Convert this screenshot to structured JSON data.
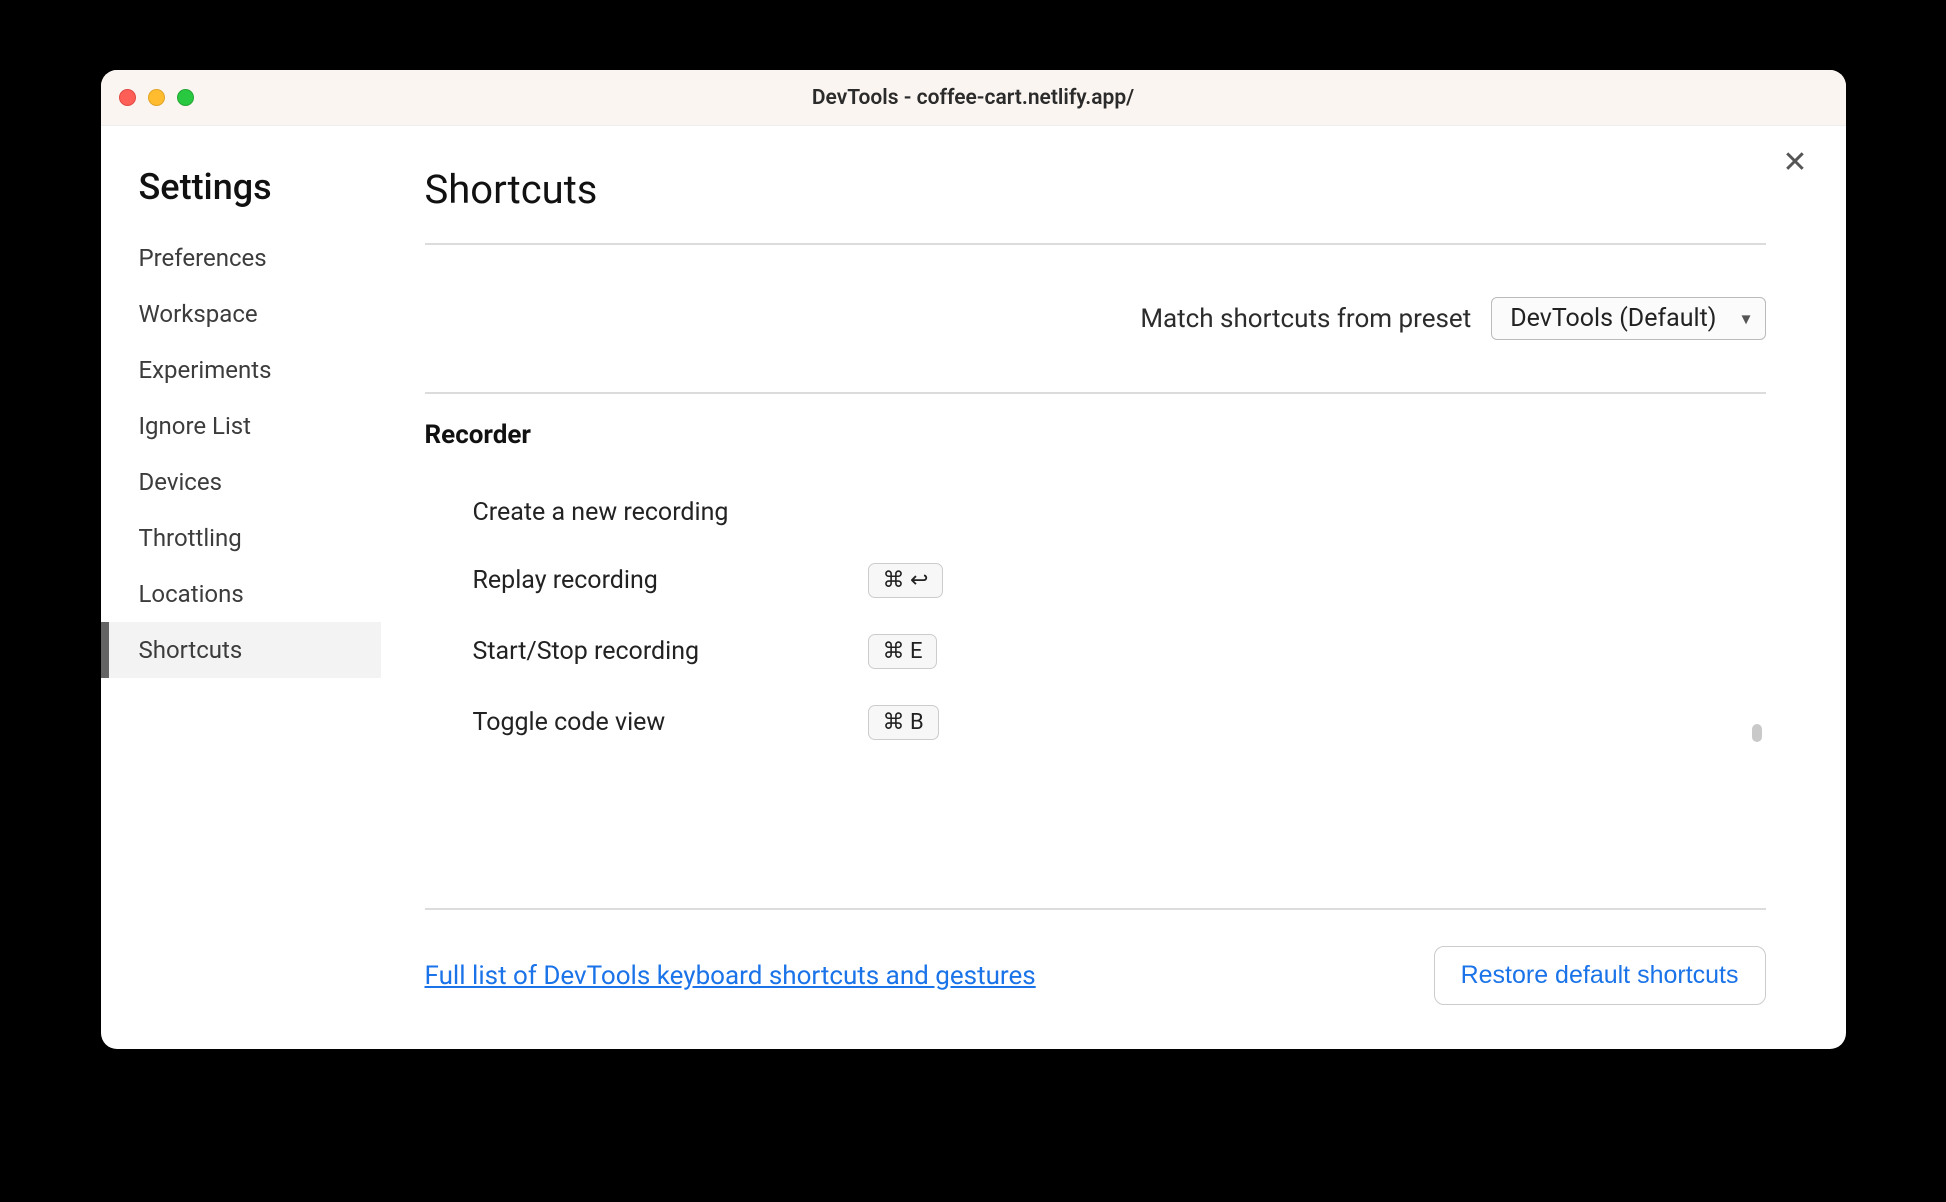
{
  "window": {
    "title": "DevTools - coffee-cart.netlify.app/"
  },
  "sidebar": {
    "title": "Settings",
    "items": [
      {
        "label": "Preferences",
        "selected": false
      },
      {
        "label": "Workspace",
        "selected": false
      },
      {
        "label": "Experiments",
        "selected": false
      },
      {
        "label": "Ignore List",
        "selected": false
      },
      {
        "label": "Devices",
        "selected": false
      },
      {
        "label": "Throttling",
        "selected": false
      },
      {
        "label": "Locations",
        "selected": false
      },
      {
        "label": "Shortcuts",
        "selected": true
      }
    ]
  },
  "page": {
    "heading": "Shortcuts",
    "preset_label": "Match shortcuts from preset",
    "preset_value": "DevTools (Default)"
  },
  "section": {
    "title": "Recorder",
    "rows": [
      {
        "desc": "Create a new recording",
        "keys": ""
      },
      {
        "desc": "Replay recording",
        "keys": "⌘  ↩"
      },
      {
        "desc": "Start/Stop recording",
        "keys": "⌘  E"
      },
      {
        "desc": "Toggle code view",
        "keys": "⌘  B"
      }
    ]
  },
  "footer": {
    "link": "Full list of DevTools keyboard shortcuts and gestures",
    "restore": "Restore default shortcuts"
  }
}
